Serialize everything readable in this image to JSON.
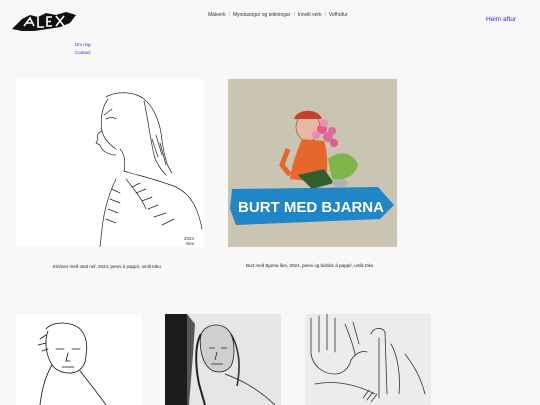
{
  "logo": {
    "text": "Alex"
  },
  "topnav": {
    "items": [
      "Málverk",
      "Myndasögur og teikningar",
      "Innvilt verk",
      "Vefhúfur"
    ]
  },
  "back_link": "Heim aftur",
  "subnav": {
    "items": [
      "Um mig",
      "Contact"
    ]
  },
  "artworks": [
    {
      "caption": "Einhver með stutt nef, 2024, penni á pappír, umlit töku",
      "signature_year": "2024",
      "signature_name": "Alex"
    },
    {
      "caption": "Burt með Bjarna líen, 2024, penni og túsblór á pappír, umlit töku",
      "banner_text": "BURT MED BJARNA"
    }
  ]
}
